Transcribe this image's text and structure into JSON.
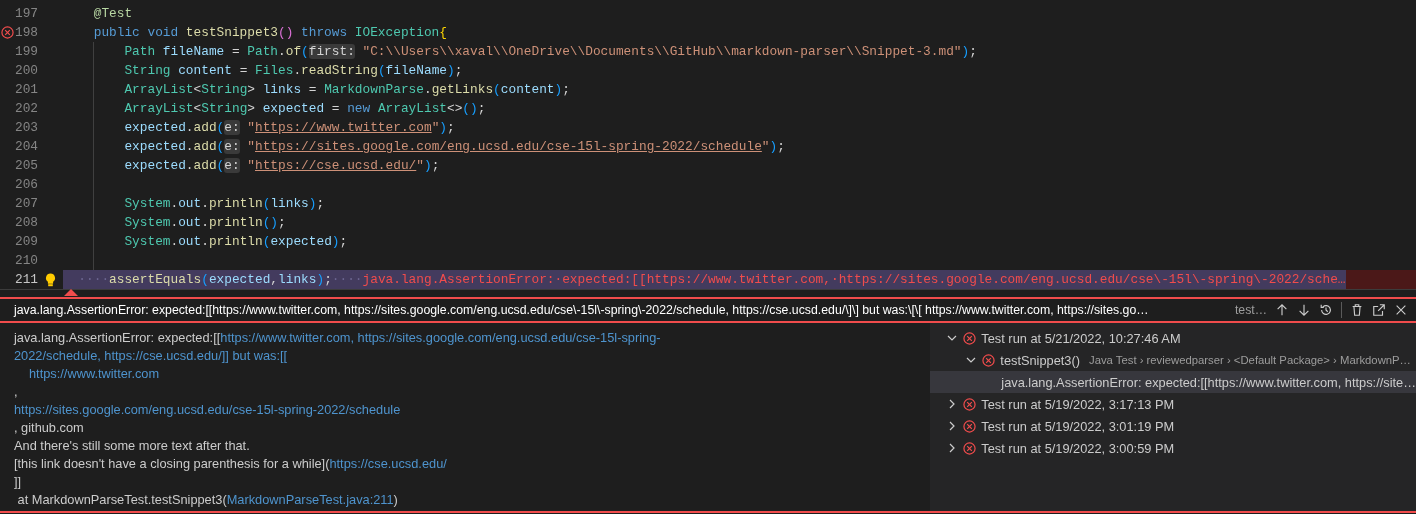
{
  "editor": {
    "lines": [
      {
        "number": "197",
        "kind": "member",
        "error": false,
        "highlighted": false,
        "lightbulb": false,
        "tokens": [
          {
            "text": "@Test",
            "kind": "ann"
          }
        ]
      },
      {
        "number": "198",
        "kind": "member",
        "error": true,
        "highlighted": false,
        "lightbulb": false,
        "tokens": [
          {
            "text": "public void ",
            "kind": "kw"
          },
          {
            "text": "testSnippet3",
            "kind": "fn"
          },
          {
            "text": "()",
            "kind": "b2"
          },
          {
            "text": " throws ",
            "kind": "kw"
          },
          {
            "text": "IOException",
            "kind": "type"
          },
          {
            "text": "{",
            "kind": "b1"
          }
        ]
      },
      {
        "number": "199",
        "kind": "body",
        "error": false,
        "highlighted": false,
        "lightbulb": false,
        "tokens": [
          {
            "text": "Path ",
            "kind": "type"
          },
          {
            "text": "fileName",
            "kind": "var"
          },
          {
            "text": " = ",
            "kind": "p"
          },
          {
            "text": "Path",
            "kind": "type"
          },
          {
            "text": ".",
            "kind": "p"
          },
          {
            "text": "of",
            "kind": "fn"
          },
          {
            "text": "(",
            "kind": "b3"
          },
          {
            "text": "first:",
            "kind": "hint"
          },
          {
            "text": "\"C:\\\\Users\\\\xaval\\\\OneDrive\\\\Documents\\\\GitHub\\\\markdown-parser\\\\Snippet-3.md\"",
            "kind": "str"
          },
          {
            "text": ")",
            "kind": "b3"
          },
          {
            "text": ";",
            "kind": "p"
          }
        ]
      },
      {
        "number": "200",
        "kind": "body",
        "error": false,
        "highlighted": false,
        "lightbulb": false,
        "tokens": [
          {
            "text": "String ",
            "kind": "type"
          },
          {
            "text": "content",
            "kind": "var"
          },
          {
            "text": " = ",
            "kind": "p"
          },
          {
            "text": "Files",
            "kind": "type"
          },
          {
            "text": ".",
            "kind": "p"
          },
          {
            "text": "readString",
            "kind": "fn"
          },
          {
            "text": "(",
            "kind": "b3"
          },
          {
            "text": "fileName",
            "kind": "var"
          },
          {
            "text": ")",
            "kind": "b3"
          },
          {
            "text": ";",
            "kind": "p"
          }
        ]
      },
      {
        "number": "201",
        "kind": "body",
        "error": false,
        "highlighted": false,
        "lightbulb": false,
        "tokens": [
          {
            "text": "ArrayList",
            "kind": "type"
          },
          {
            "text": "<",
            "kind": "p"
          },
          {
            "text": "String",
            "kind": "type"
          },
          {
            "text": "> ",
            "kind": "p"
          },
          {
            "text": "links",
            "kind": "var"
          },
          {
            "text": " = ",
            "kind": "p"
          },
          {
            "text": "MarkdownParse",
            "kind": "type"
          },
          {
            "text": ".",
            "kind": "p"
          },
          {
            "text": "getLinks",
            "kind": "fn"
          },
          {
            "text": "(",
            "kind": "b3"
          },
          {
            "text": "content",
            "kind": "var"
          },
          {
            "text": ")",
            "kind": "b3"
          },
          {
            "text": ";",
            "kind": "p"
          }
        ]
      },
      {
        "number": "202",
        "kind": "body",
        "error": false,
        "highlighted": false,
        "lightbulb": false,
        "tokens": [
          {
            "text": "ArrayList",
            "kind": "type"
          },
          {
            "text": "<",
            "kind": "p"
          },
          {
            "text": "String",
            "kind": "type"
          },
          {
            "text": "> ",
            "kind": "p"
          },
          {
            "text": "expected",
            "kind": "var"
          },
          {
            "text": " = ",
            "kind": "p"
          },
          {
            "text": "new ",
            "kind": "kw"
          },
          {
            "text": "ArrayList",
            "kind": "type"
          },
          {
            "text": "<>",
            "kind": "p"
          },
          {
            "text": "()",
            "kind": "b3"
          },
          {
            "text": ";",
            "kind": "p"
          }
        ]
      },
      {
        "number": "203",
        "kind": "body",
        "error": false,
        "highlighted": false,
        "lightbulb": false,
        "tokens": [
          {
            "text": "expected",
            "kind": "var"
          },
          {
            "text": ".",
            "kind": "p"
          },
          {
            "text": "add",
            "kind": "fn"
          },
          {
            "text": "(",
            "kind": "b3"
          },
          {
            "text": "e:",
            "kind": "hint"
          },
          {
            "text": "\"",
            "kind": "str"
          },
          {
            "text": "https://www.twitter.com",
            "kind": "url"
          },
          {
            "text": "\"",
            "kind": "str"
          },
          {
            "text": ")",
            "kind": "b3"
          },
          {
            "text": ";",
            "kind": "p"
          }
        ]
      },
      {
        "number": "204",
        "kind": "body",
        "error": false,
        "highlighted": false,
        "lightbulb": false,
        "tokens": [
          {
            "text": "expected",
            "kind": "var"
          },
          {
            "text": ".",
            "kind": "p"
          },
          {
            "text": "add",
            "kind": "fn"
          },
          {
            "text": "(",
            "kind": "b3"
          },
          {
            "text": "e:",
            "kind": "hint"
          },
          {
            "text": "\"",
            "kind": "str"
          },
          {
            "text": "https://sites.google.com/eng.ucsd.edu/cse-15l-spring-2022/schedule",
            "kind": "url"
          },
          {
            "text": "\"",
            "kind": "str"
          },
          {
            "text": ")",
            "kind": "b3"
          },
          {
            "text": ";",
            "kind": "p"
          }
        ]
      },
      {
        "number": "205",
        "kind": "body",
        "error": false,
        "highlighted": false,
        "lightbulb": false,
        "tokens": [
          {
            "text": "expected",
            "kind": "var"
          },
          {
            "text": ".",
            "kind": "p"
          },
          {
            "text": "add",
            "kind": "fn"
          },
          {
            "text": "(",
            "kind": "b3"
          },
          {
            "text": "e:",
            "kind": "hint"
          },
          {
            "text": "\"",
            "kind": "str"
          },
          {
            "text": "https://cse.ucsd.edu/",
            "kind": "url"
          },
          {
            "text": "\"",
            "kind": "str"
          },
          {
            "text": ")",
            "kind": "b3"
          },
          {
            "text": ";",
            "kind": "p"
          }
        ]
      },
      {
        "number": "206",
        "kind": "blank",
        "error": false,
        "highlighted": false,
        "lightbulb": false
      },
      {
        "number": "207",
        "kind": "body",
        "error": false,
        "highlighted": false,
        "lightbulb": false,
        "tokens": [
          {
            "text": "System",
            "kind": "type"
          },
          {
            "text": ".",
            "kind": "p"
          },
          {
            "text": "out",
            "kind": "var"
          },
          {
            "text": ".",
            "kind": "p"
          },
          {
            "text": "println",
            "kind": "fn"
          },
          {
            "text": "(",
            "kind": "b3"
          },
          {
            "text": "links",
            "kind": "var"
          },
          {
            "text": ")",
            "kind": "b3"
          },
          {
            "text": ";",
            "kind": "p"
          }
        ]
      },
      {
        "number": "208",
        "kind": "body",
        "error": false,
        "highlighted": false,
        "lightbulb": false,
        "tokens": [
          {
            "text": "System",
            "kind": "type"
          },
          {
            "text": ".",
            "kind": "p"
          },
          {
            "text": "out",
            "kind": "var"
          },
          {
            "text": ".",
            "kind": "p"
          },
          {
            "text": "println",
            "kind": "fn"
          },
          {
            "text": "()",
            "kind": "b3"
          },
          {
            "text": ";",
            "kind": "p"
          }
        ]
      },
      {
        "number": "209",
        "kind": "body",
        "error": false,
        "highlighted": false,
        "lightbulb": false,
        "tokens": [
          {
            "text": "System",
            "kind": "type"
          },
          {
            "text": ".",
            "kind": "p"
          },
          {
            "text": "out",
            "kind": "var"
          },
          {
            "text": ".",
            "kind": "p"
          },
          {
            "text": "println",
            "kind": "fn"
          },
          {
            "text": "(",
            "kind": "b3"
          },
          {
            "text": "expected",
            "kind": "var"
          },
          {
            "text": ")",
            "kind": "b3"
          },
          {
            "text": ";",
            "kind": "p"
          }
        ]
      },
      {
        "number": "210",
        "kind": "blank",
        "error": false,
        "highlighted": false,
        "lightbulb": false
      },
      {
        "number": "211",
        "kind": "member",
        "error": false,
        "highlighted": true,
        "lightbulb": true,
        "tokens": [
          {
            "text": "····",
            "kind": "dots"
          },
          {
            "text": "assertEquals",
            "kind": "fn"
          },
          {
            "text": "(",
            "kind": "b3"
          },
          {
            "text": "expected",
            "kind": "var"
          },
          {
            "text": ",",
            "kind": "p"
          },
          {
            "text": "links",
            "kind": "var"
          },
          {
            "text": ")",
            "kind": "b3"
          },
          {
            "text": ";",
            "kind": "p"
          },
          {
            "text": "····",
            "kind": "dots"
          }
        ],
        "inline_error": "java.lang.AssertionError:·expected:[[https://www.twitter.com,·https://sites.google.com/eng.ucsd.edu/cse\\-15l\\-spring\\-2022/sche…"
      }
    ]
  },
  "peek": {
    "message": "java.lang.AssertionError: expected:[[https://www.twitter.com, https://sites.google.com/eng.ucsd.edu/cse\\-15l\\-spring\\-2022/schedule, https://cse.ucsd.edu/\\]\\] but was:\\[\\[ https://www.twitter.com, https://sites.go…",
    "source": "test…",
    "output": [
      {
        "indent": false,
        "segments": [
          {
            "text": "java.lang.AssertionError: expected:[[",
            "link": false
          },
          {
            "text": "https://www.twitter.com, https://sites.google.com/eng.ucsd.edu/cse-15l-spring-",
            "link": true
          }
        ]
      },
      {
        "indent": false,
        "segments": [
          {
            "text": "2022/schedule, https://cse.ucsd.edu/]] but was:[[",
            "link": true
          }
        ]
      },
      {
        "indent": true,
        "segments": [
          {
            "text": "https://www.twitter.com",
            "link": true
          }
        ]
      },
      {
        "indent": false,
        "segments": [
          {
            "text": ",",
            "link": false
          }
        ]
      },
      {
        "indent": false,
        "segments": [
          {
            "text": "https://sites.google.com/eng.ucsd.edu/cse-15l-spring-2022/schedule",
            "link": true
          }
        ]
      },
      {
        "indent": false,
        "segments": [
          {
            "text": ", github.com",
            "link": false
          }
        ]
      },
      {
        "indent": false,
        "segments": [
          {
            "text": "And there's still some more text after that.",
            "link": false
          }
        ]
      },
      {
        "indent": false,
        "segments": [
          {
            "text": "[this link doesn't have a closing parenthesis for a while](",
            "link": false
          },
          {
            "text": "https://cse.ucsd.edu/",
            "link": true
          }
        ]
      },
      {
        "indent": false,
        "segments": [
          {
            "text": "]]",
            "link": false
          }
        ]
      },
      {
        "indent": false,
        "segments": [
          {
            "text": " at MarkdownParseTest.testSnippet3(",
            "link": false
          },
          {
            "text": "MarkdownParseTest.java:211",
            "link": true
          },
          {
            "text": ")",
            "link": false
          }
        ]
      }
    ],
    "tree": {
      "items": [
        {
          "kind": "run",
          "label": "Test run at 5/21/2022, 10:27:46 AM",
          "failed": true,
          "expanded": true,
          "selected": false,
          "children": [
            {
              "kind": "test",
              "label": "testSnippet3()",
              "description": "Java Test › reviewedparser › <Default Package> › MarkdownP…",
              "failed": true,
              "expanded": true,
              "selected": false,
              "children": [
                {
                  "kind": "message",
                  "label": "java.lang.AssertionError: expected:[[https://www.twitter.com, https://site…",
                  "selected": true
                }
              ]
            }
          ]
        },
        {
          "kind": "run",
          "label": "Test run at 5/19/2022, 3:17:13 PM",
          "failed": true,
          "expanded": false,
          "selected": false
        },
        {
          "kind": "run",
          "label": "Test run at 5/19/2022, 3:01:19 PM",
          "failed": true,
          "expanded": false,
          "selected": false
        },
        {
          "kind": "run",
          "label": "Test run at 5/19/2022, 3:00:59 PM",
          "failed": true,
          "expanded": false,
          "selected": false
        }
      ]
    }
  }
}
